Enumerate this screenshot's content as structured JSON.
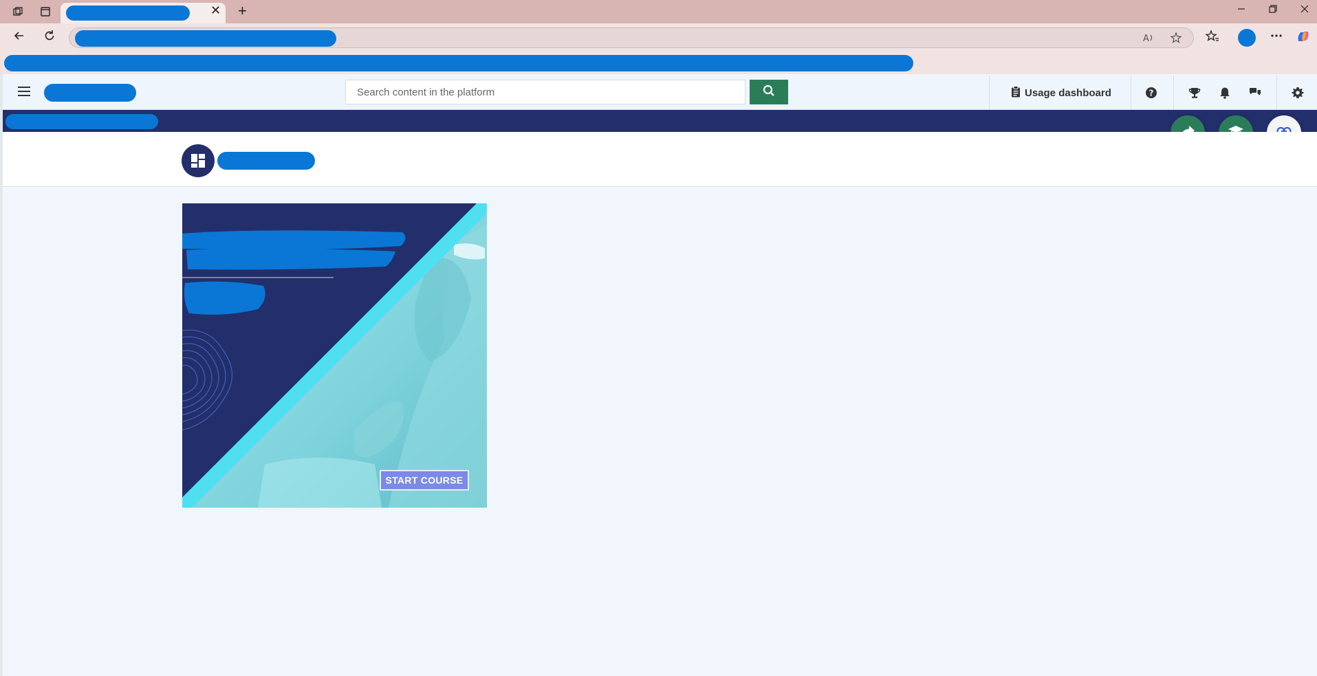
{
  "browser": {
    "tab_close": "✕",
    "new_tab": "+"
  },
  "header": {
    "search_placeholder": "Search content in the platform",
    "usage_dashboard": "Usage dashboard"
  },
  "course_card": {
    "start_label": "START COURSE"
  },
  "colors": {
    "navy": "#232f6b",
    "green": "#2b7d5a",
    "cyan": "#4ee0f0",
    "button": "#7a8ae6"
  }
}
